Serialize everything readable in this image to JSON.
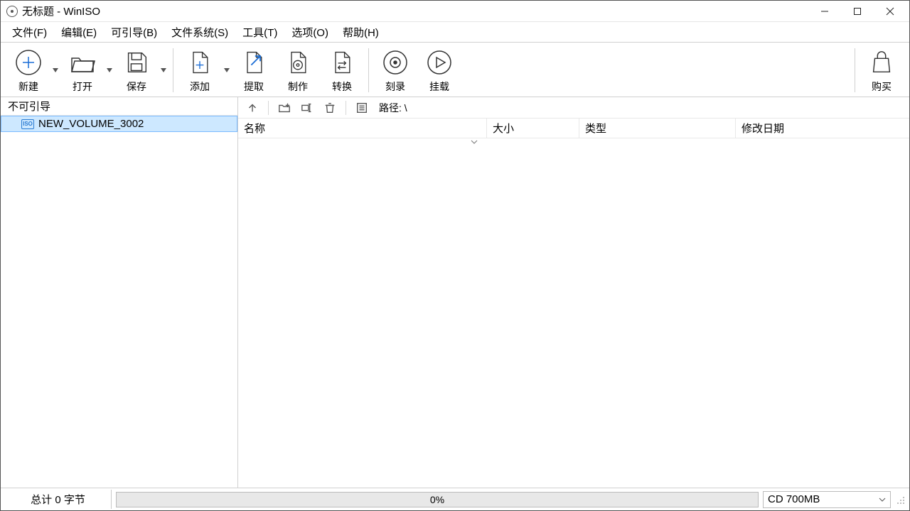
{
  "window": {
    "title": "无标题 - WinISO"
  },
  "menu": {
    "file": "文件(F)",
    "edit": "编辑(E)",
    "boot": "可引导(B)",
    "filesystem": "文件系统(S)",
    "tools": "工具(T)",
    "options": "选项(O)",
    "help": "帮助(H)"
  },
  "toolbar": {
    "new": "新建",
    "open": "打开",
    "save": "保存",
    "add": "添加",
    "extract": "提取",
    "make": "制作",
    "convert": "转换",
    "burn": "刻录",
    "mount": "挂载",
    "buy": "购买"
  },
  "sidebar": {
    "header": "不可引导",
    "tree": [
      {
        "label": "NEW_VOLUME_3002"
      }
    ]
  },
  "content": {
    "path_prefix": "路径:",
    "path_value": "\\",
    "columns": {
      "name": "名称",
      "size": "大小",
      "type": "类型",
      "date": "修改日期"
    }
  },
  "status": {
    "totals": "总计 0 字节",
    "progress": "0%",
    "disc_size": "CD 700MB"
  }
}
